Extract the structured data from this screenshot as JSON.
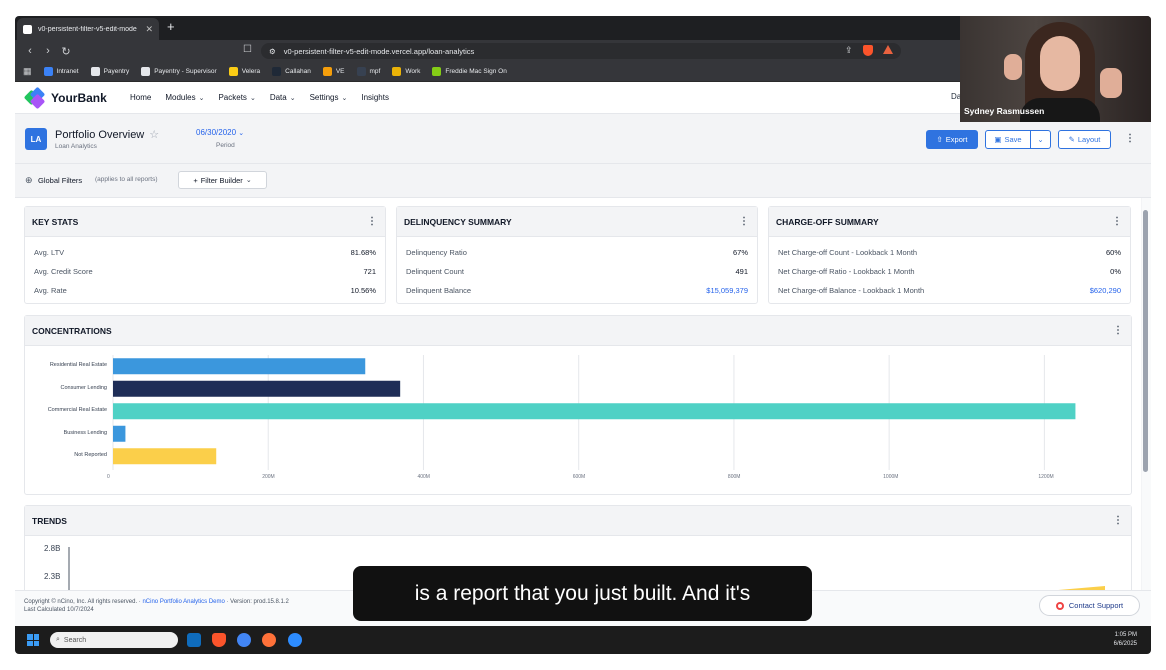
{
  "browser": {
    "tab_title": "v0-persistent-filter-v5-edit-mode",
    "new_tab": "+",
    "url": "v0-persistent-filter-v5-edit-mode.vercel.app/loan-analytics",
    "bookmarks": [
      {
        "label": "Intranet",
        "icon": "intranet-icon",
        "color": "#3b82f6"
      },
      {
        "label": "Payentry",
        "icon": "page-icon",
        "color": "#e5e7eb"
      },
      {
        "label": "Payentry - Supervisor",
        "icon": "globe-icon",
        "color": "#e5e7eb"
      },
      {
        "label": "Velera",
        "icon": "velera-icon",
        "color": "#facc15"
      },
      {
        "label": "Callahan",
        "icon": "callahan-icon",
        "color": "#1f2937"
      },
      {
        "label": "VE",
        "icon": "chart-icon",
        "color": "#f59e0b"
      },
      {
        "label": "mpf",
        "icon": "mpf-icon",
        "color": "#374151"
      },
      {
        "label": "Work",
        "icon": "folder-icon",
        "color": "#eab308"
      },
      {
        "label": "Freddie Mac Sign On",
        "icon": "freddie-icon",
        "color": "#84cc16"
      }
    ]
  },
  "app": {
    "brand": "YourBank",
    "nav": [
      {
        "label": "Home",
        "dropdown": false
      },
      {
        "label": "Modules",
        "dropdown": true
      },
      {
        "label": "Packets",
        "dropdown": true
      },
      {
        "label": "Data",
        "dropdown": true
      },
      {
        "label": "Settings",
        "dropdown": true
      },
      {
        "label": "Insights",
        "dropdown": false
      }
    ],
    "user_initials": "Da"
  },
  "page": {
    "badge": "LA",
    "title": "Portfolio Overview",
    "subtitle": "Loan Analytics",
    "period_value": "06/30/2020",
    "period_label": "Period",
    "export": "Export",
    "save": "Save",
    "layout": "Layout"
  },
  "filters": {
    "label": "Global Filters",
    "note": "(applies to all reports)",
    "builder": "Filter Builder"
  },
  "key_stats": {
    "title": "KEY STATS",
    "rows": [
      {
        "label": "Avg. LTV",
        "value": "81.68%"
      },
      {
        "label": "Avg. Credit Score",
        "value": "721"
      },
      {
        "label": "Avg. Rate",
        "value": "10.56%"
      }
    ]
  },
  "delinquency": {
    "title": "DELINQUENCY SUMMARY",
    "rows": [
      {
        "label": "Delinquency Ratio",
        "value": "67%"
      },
      {
        "label": "Delinquent Count",
        "value": "491"
      },
      {
        "label": "Delinquent Balance",
        "value": "$15,059,379"
      }
    ]
  },
  "chargeoff": {
    "title": "CHARGE-OFF SUMMARY",
    "rows": [
      {
        "label": "Net Charge-off Count - Lookback 1 Month",
        "value": "60%"
      },
      {
        "label": "Net Charge-off Ratio - Lookback 1 Month",
        "value": "0%"
      },
      {
        "label": "Net Charge-off Balance - Lookback 1 Month",
        "value": "$620,290"
      }
    ]
  },
  "concentrations": {
    "title": "CONCENTRATIONS"
  },
  "chart_data": [
    {
      "type": "bar",
      "orientation": "horizontal",
      "categories": [
        "Residential Real Estate",
        "Consumer Lending",
        "Commercial Real Estate",
        "Business Lending",
        "Not Reported"
      ],
      "values": [
        325,
        370,
        1240,
        16,
        133
      ],
      "colors": [
        "#3b97dd",
        "#1e2d57",
        "#4fd1c5",
        "#3b97dd",
        "#fbcf4a"
      ],
      "xlim": [
        0,
        1300
      ],
      "xticks": [
        0,
        200,
        400,
        600,
        800,
        1000,
        1200
      ],
      "xtick_labels": [
        "0",
        "200M",
        "400M",
        "600M",
        "800M",
        "1000M",
        "1200M"
      ],
      "grid": true,
      "title": "",
      "xlabel": "",
      "ylabel": ""
    },
    {
      "type": "area",
      "title": "",
      "ytick_labels": [
        "2.8B",
        "2.3B"
      ],
      "colors": [
        "#fbcf4a",
        "#4fd1c5"
      ]
    }
  ],
  "trends": {
    "title": "TRENDS"
  },
  "footer": {
    "copyright": "Copyright © nCino, Inc. All rights reserved. · ",
    "link": "nCino Portfolio Analytics Demo",
    "version": " · Version: prod.15.8.1.2",
    "last_calc": "Last Calculated 10/7/2024",
    "contact": "Contact Support"
  },
  "caption": "is a report that you just built. And it's",
  "taskbar": {
    "search": "Search",
    "time": "1:05 PM",
    "date": "6/6/2025"
  },
  "webcam": {
    "name": "Sydney Rasmussen"
  }
}
